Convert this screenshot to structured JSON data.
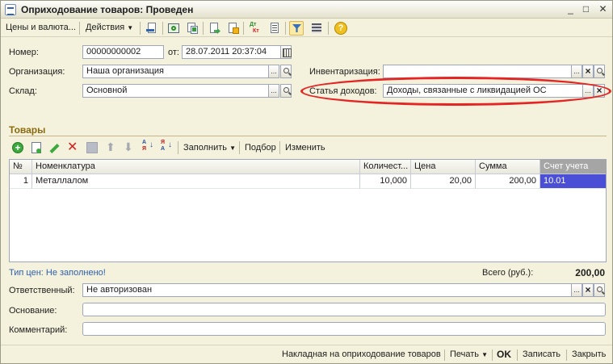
{
  "window": {
    "title": "Оприходование товаров: Проведен",
    "btn_minimize": "_",
    "btn_maximize": "□",
    "btn_close": "✕"
  },
  "toolbar": {
    "prices_currency": "Цены и валюта...",
    "actions": "Действия",
    "help": "?"
  },
  "form": {
    "number_label": "Номер:",
    "number_value": "00000000002",
    "date_label": "от:",
    "date_value": "28.07.2011 20:37:04",
    "org_label": "Организация:",
    "org_value": "Наша организация",
    "warehouse_label": "Склад:",
    "warehouse_value": "Основной",
    "inventory_label": "Инвентаризация:",
    "inventory_value": "",
    "income_item_label": "Статья доходов:",
    "income_item_value": "Доходы, связанные с ликвидацией ОС"
  },
  "goods": {
    "section_title": "Товары",
    "fill_label": "Заполнить",
    "select_label": "Подбор",
    "edit_label": "Изменить",
    "columns": [
      "№",
      "Номенклатура",
      "Количест...",
      "Цена",
      "Сумма",
      "Счет учета"
    ],
    "rows": [
      [
        "1",
        "Металлалом",
        "10,000",
        "20,00",
        "200,00",
        "10.01"
      ]
    ]
  },
  "summary": {
    "price_type": "Тип цен: Не заполнено!",
    "total_label": "Всего (руб.):",
    "total_value": "200,00"
  },
  "bottom": {
    "responsible_label": "Ответственный:",
    "responsible_value": "Не авторизован",
    "basis_label": "Основание:",
    "basis_value": "",
    "comment_label": "Комментарий:",
    "comment_value": ""
  },
  "footer": {
    "invoice": "Накладная на оприходование товаров",
    "print": "Печать",
    "ok": "OK",
    "save": "Записать",
    "close": "Закрыть"
  },
  "colors": {
    "window_bg": "#f4f2dc",
    "selection": "#4b4fd6",
    "annotation": "#e52424",
    "section_title": "#8b6a0e",
    "link_text": "#2a5fb0"
  }
}
